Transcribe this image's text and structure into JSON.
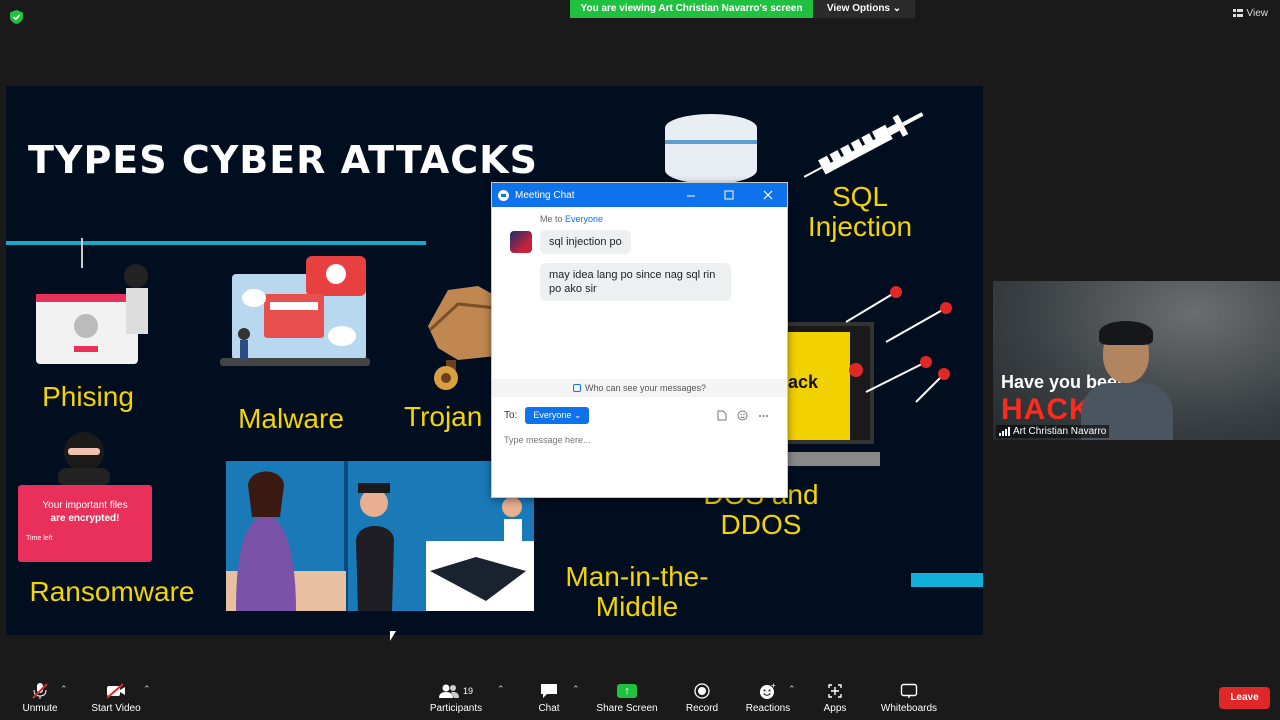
{
  "banner": {
    "viewing_text": "You are viewing Art Christian Navarro's screen",
    "view_options_label": "View Options ⌄",
    "view_label": "View"
  },
  "slide": {
    "title": "TYPES CYBER ATTACKS",
    "labels": {
      "phishing": "Phising",
      "malware": "Malware",
      "trojan": "Trojan",
      "sql_line1": "SQL",
      "sql_line2": "Injection",
      "dos_line1": "DOS and",
      "dos_line2": "DDOS",
      "ransomware": "Ransomware",
      "mitm_line1": "Man-in-the-",
      "mitm_line2": "Middle"
    },
    "ransom_card": {
      "line1": "Your important files",
      "line2": "are encrypted!",
      "line3": "Time left"
    },
    "laptop_text": "ack"
  },
  "chat": {
    "title": "Meeting Chat",
    "header_from": "Me to",
    "header_to": "Everyone",
    "messages": [
      {
        "text": "sql injection po"
      },
      {
        "text": "may idea lang po since nag sql rin po ako sir"
      }
    ],
    "who_can_see": "Who can see your messages?",
    "to_label": "To:",
    "to_value": "Everyone ⌄",
    "input_placeholder": "Type message here..."
  },
  "video": {
    "overlay_line1": "Have you been",
    "overlay_line2": "HACK",
    "name": "Art Christian Navarro"
  },
  "toolbar": {
    "unmute": "Unmute",
    "start_video": "Start Video",
    "participants": "Participants",
    "participants_count": "19",
    "chat": "Chat",
    "share_screen": "Share Screen",
    "record": "Record",
    "reactions": "Reactions",
    "apps": "Apps",
    "whiteboards": "Whiteboards",
    "leave": "Leave"
  },
  "colors": {
    "zoom_blue": "#0e72ed",
    "share_green": "#20c141",
    "leave_red": "#e02828",
    "slide_bg": "#000e20",
    "slide_label_yellow": "#f5d400"
  }
}
